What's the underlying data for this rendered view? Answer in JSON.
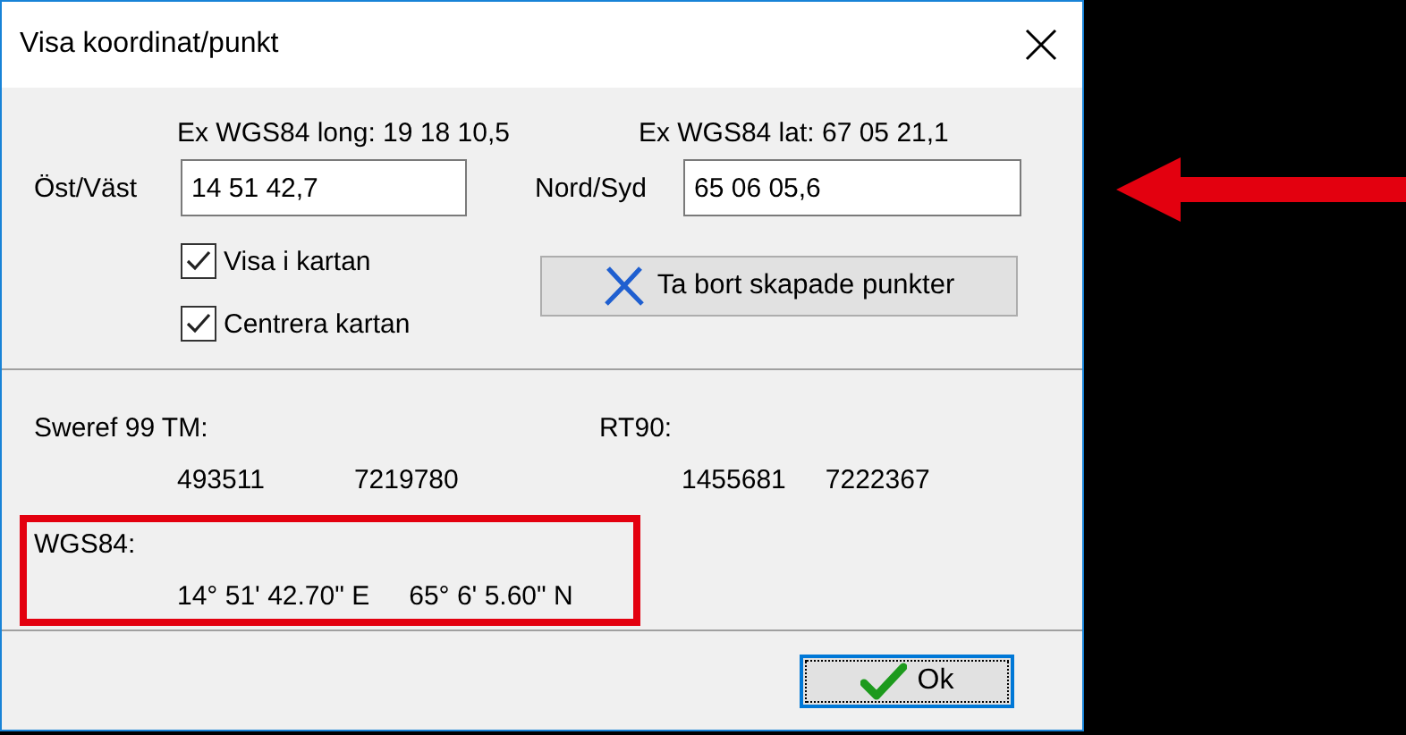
{
  "window": {
    "title": "Visa koordinat/punkt"
  },
  "examples": [
    "Ex WGS84 long: 19 18 10,5",
    "Ex WGS84 lat: 67 05 21,1"
  ],
  "fields": [
    {
      "label": "Öst/Väst",
      "value": "14 51 42,7"
    },
    {
      "label": "Nord/Syd",
      "value": "65 06 05,6"
    }
  ],
  "checkboxes": [
    {
      "label": "Visa i kartan",
      "checked": true
    },
    {
      "label": "Centrera kartan",
      "checked": true
    }
  ],
  "delete_button": {
    "label": "Ta bort skapade punkter"
  },
  "results": [
    {
      "label": "Sweref 99 TM:",
      "values": [
        "493511",
        "7219780"
      ],
      "highlighted": false
    },
    {
      "label": "RT90:",
      "values": [
        "1455681",
        "7222367"
      ],
      "highlighted": false
    },
    {
      "label": "WGS84:",
      "values": [
        "14° 51' 42.70\" E",
        "65° 6' 5.60\" N"
      ],
      "highlighted": true
    }
  ],
  "ok_button": {
    "label": "Ok",
    "focused": true
  }
}
